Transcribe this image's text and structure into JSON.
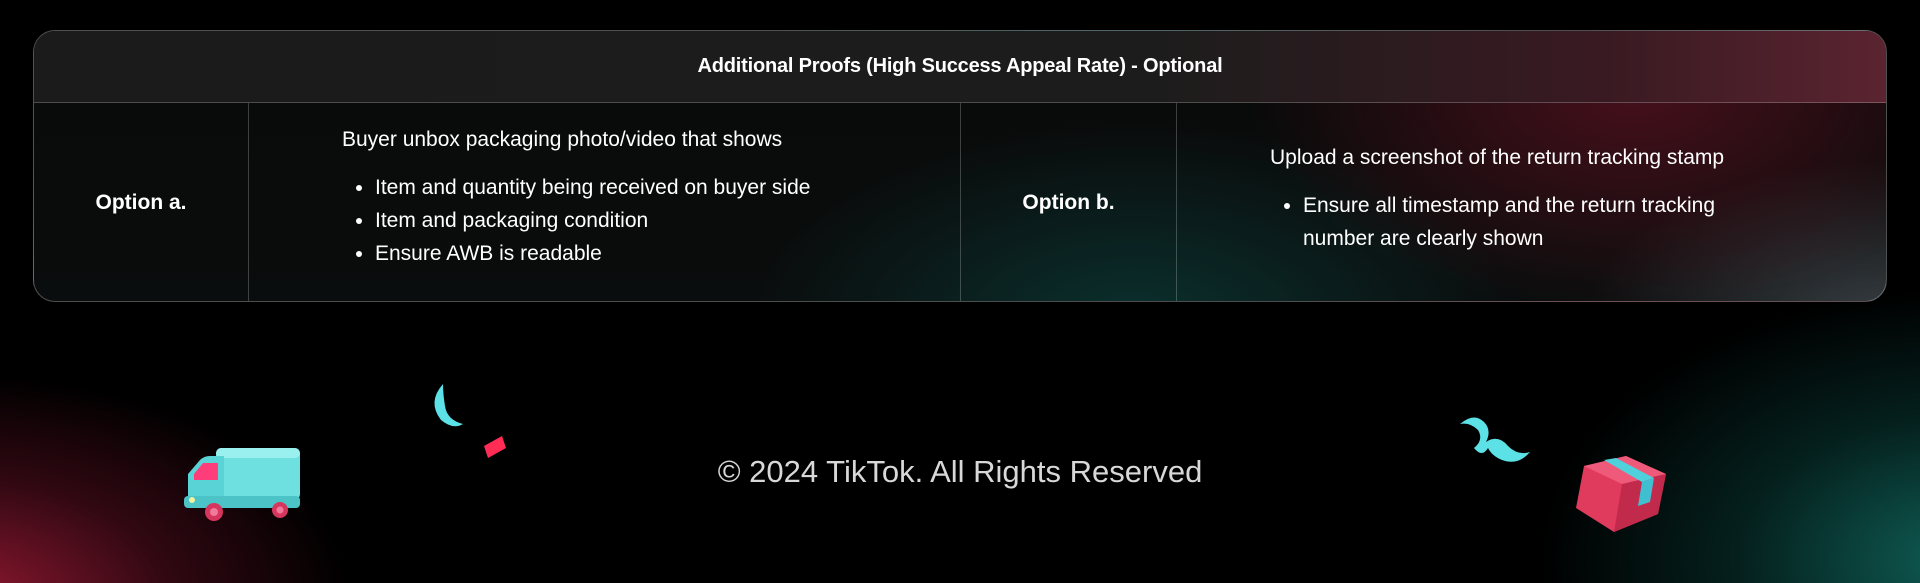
{
  "table": {
    "header": "Additional Proofs (High Success Appeal Rate) - Optional",
    "option_a": {
      "label": "Option a.",
      "intro": "Buyer unbox packaging photo/video that shows",
      "bullets": [
        "Item and quantity being received on buyer side",
        "Item and packaging condition",
        "Ensure AWB is readable"
      ]
    },
    "option_b": {
      "label": "Option b.",
      "intro": "Upload a screenshot of the return tracking stamp",
      "bullets": [
        "Ensure all timestamp and the return tracking number are clearly shown"
      ]
    }
  },
  "footer": {
    "copyright": "© 2024 TikTok. All Rights Reserved"
  },
  "decorations": {
    "truck_icon": "delivery-truck-icon",
    "box_icon": "parcel-box-icon",
    "accent_cyan": "#5ce1e6",
    "accent_pink": "#ff2d55"
  }
}
